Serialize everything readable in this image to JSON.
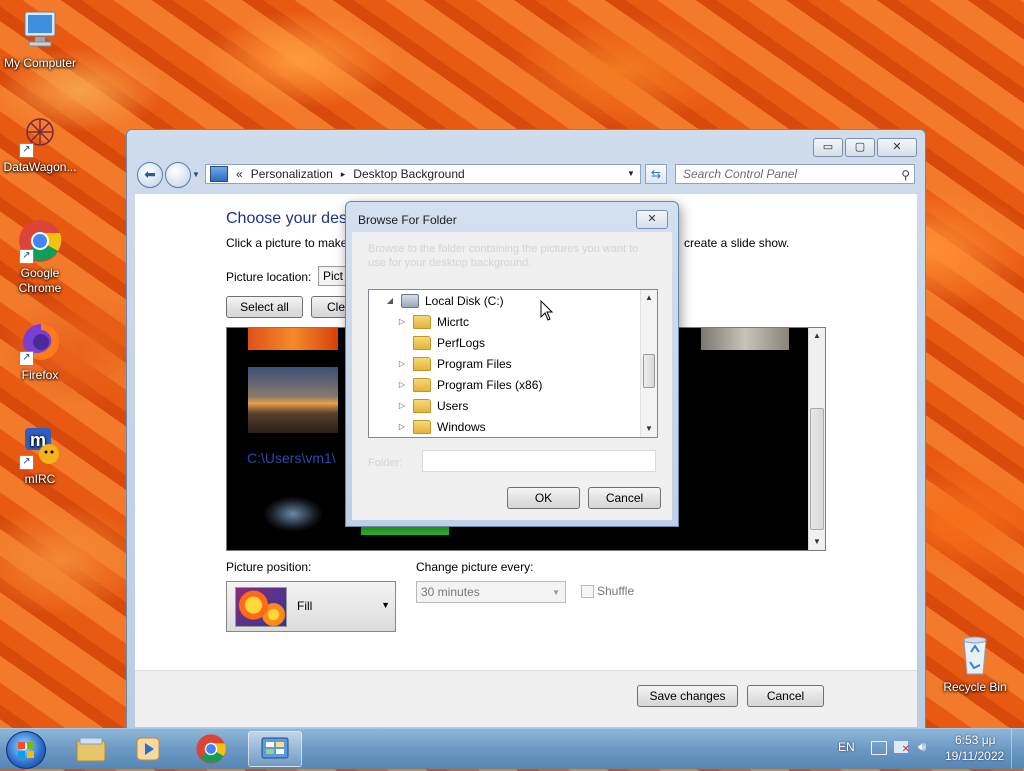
{
  "desktop": {
    "icons": [
      {
        "label": "My Computer",
        "icon": "computer-icon"
      },
      {
        "label": "DataWagon...",
        "icon": "datawagon-icon"
      },
      {
        "label": "Google Chrome",
        "icon": "chrome-icon"
      },
      {
        "label": "Firefox",
        "icon": "firefox-icon"
      },
      {
        "label": "mIRC",
        "icon": "mirc-icon"
      },
      {
        "label": "Recycle Bin",
        "icon": "recycle-bin-icon"
      }
    ]
  },
  "window": {
    "caption_buttons": {
      "minimize": "▭",
      "maximize": "▢",
      "close": "✕"
    },
    "address": {
      "prefix": "«",
      "crumb1": "Personalization",
      "sep": "▸",
      "crumb2": "Desktop Background"
    },
    "search_placeholder": "Search Control Panel",
    "heading": "Choose your desk",
    "description": "Click a picture to make",
    "description_end": "create a slide show.",
    "picture_location_label": "Picture location:",
    "picture_location_value": "Pict",
    "select_all": "Select all",
    "clear_all": "Clea",
    "gallery_path": "C:\\Users\\vm1\\",
    "picture_position_label": "Picture position:",
    "picture_position_value": "Fill",
    "change_picture_label": "Change picture every:",
    "change_picture_value": "30 minutes",
    "shuffle_label": "Shuffle",
    "save_changes": "Save changes",
    "cancel": "Cancel"
  },
  "dialog": {
    "title": "Browse For Folder",
    "close": "✕",
    "instruction": "Browse to the folder containing the pictures you want to use for your desktop background.",
    "tree": [
      {
        "label": "Local Disk (C:)",
        "type": "drive",
        "expanded": true
      },
      {
        "label": "Micrtc",
        "type": "folder",
        "expander": "▷"
      },
      {
        "label": "PerfLogs",
        "type": "folder",
        "expander": ""
      },
      {
        "label": "Program Files",
        "type": "folder",
        "expander": "▷"
      },
      {
        "label": "Program Files (x86)",
        "type": "folder",
        "expander": "▷"
      },
      {
        "label": "Users",
        "type": "folder",
        "expander": "▷"
      },
      {
        "label": "Windows",
        "type": "folder",
        "expander": "▷"
      }
    ],
    "folder_label": "Folder:",
    "folder_value": "",
    "ok": "OK",
    "cancel": "Cancel"
  },
  "taskbar": {
    "items": [
      "windows-explorer-icon",
      "media-player-icon",
      "chrome-icon",
      "control-panel-icon"
    ],
    "language": "EN",
    "time": "6:53 μμ",
    "date": "19/11/2022"
  },
  "colors": {
    "heading": "#1e3287",
    "link_blue": "#2a4aa8",
    "taskbar": "#6f9cc6"
  }
}
